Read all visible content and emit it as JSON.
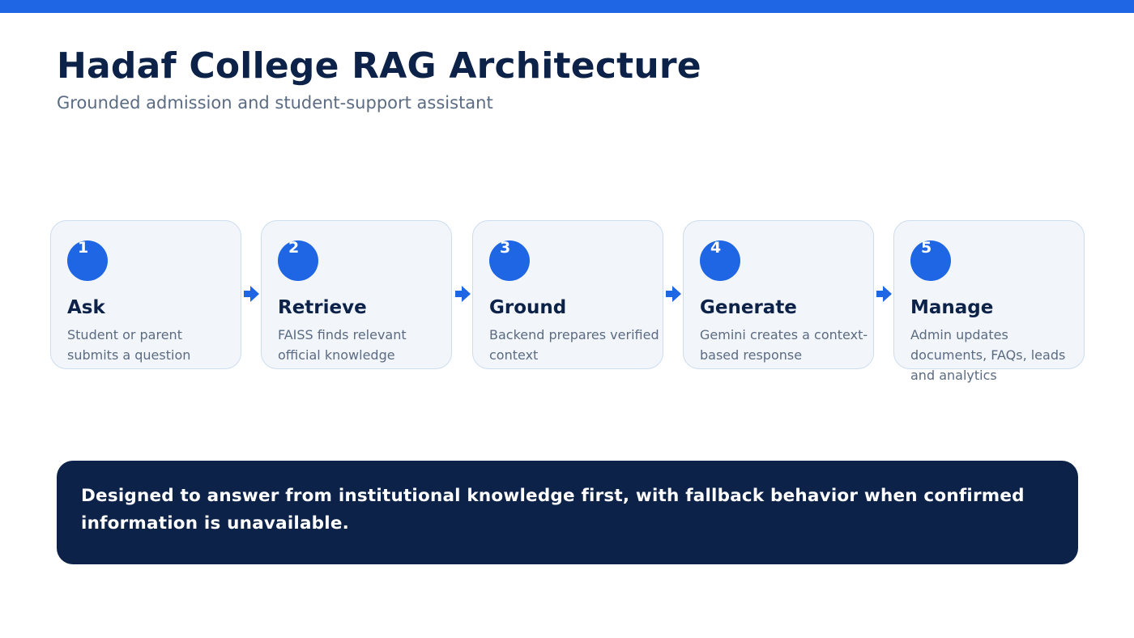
{
  "header": {
    "title": "Hadaf College RAG Architecture",
    "subtitle": "Grounded admission and student-support assistant"
  },
  "colors": {
    "accent": "#1f66e5",
    "navy": "#0c2248",
    "muted": "#5b6b82",
    "card_bg": "#f2f6fb",
    "card_border": "#cddcee"
  },
  "steps": [
    {
      "number": "1",
      "title": "Ask",
      "description": "Student or parent submits a question"
    },
    {
      "number": "2",
      "title": "Retrieve",
      "description": "FAISS finds relevant official knowledge"
    },
    {
      "number": "3",
      "title": "Ground",
      "description": "Backend prepares verified context"
    },
    {
      "number": "4",
      "title": "Generate",
      "description": "Gemini creates a context-based response"
    },
    {
      "number": "5",
      "title": "Manage",
      "description": "Admin updates documents, FAQs, leads and analytics"
    }
  ],
  "arrow_icon": "arrow-right-icon",
  "banner": {
    "text": "Designed to answer from institutional knowledge first, with fallback behavior when confirmed information is unavailable."
  }
}
